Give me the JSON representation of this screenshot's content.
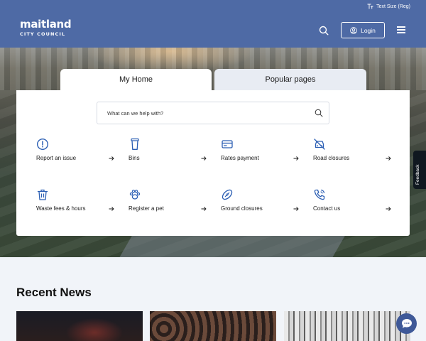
{
  "header": {
    "logo_main": "maitland",
    "logo_sub": "CITY COUNCIL",
    "text_size_label": "Text Size (Reg)",
    "login_label": "Login"
  },
  "tabs": [
    {
      "label": "My Home",
      "active": true
    },
    {
      "label": "Popular pages",
      "active": false
    }
  ],
  "search": {
    "placeholder": "What can we help with?"
  },
  "quick_links": [
    {
      "label": "Report an issue",
      "icon": "alert-circle-icon"
    },
    {
      "label": "Bins",
      "icon": "bin-icon"
    },
    {
      "label": "Rates payment",
      "icon": "credit-card-icon"
    },
    {
      "label": "Road closures",
      "icon": "car-off-icon"
    },
    {
      "label": "Waste fees & hours",
      "icon": "trash-icon"
    },
    {
      "label": "Register a pet",
      "icon": "paw-icon"
    },
    {
      "label": "Ground closures",
      "icon": "football-icon"
    },
    {
      "label": "Contact us",
      "icon": "phone-icon"
    }
  ],
  "feedback": {
    "label": "Feedback"
  },
  "news": {
    "title": "Recent News"
  },
  "colors": {
    "header_bg": "#4e6aa5",
    "icon_accent": "#2c5fb4",
    "chat_bg": "#3f5998"
  }
}
